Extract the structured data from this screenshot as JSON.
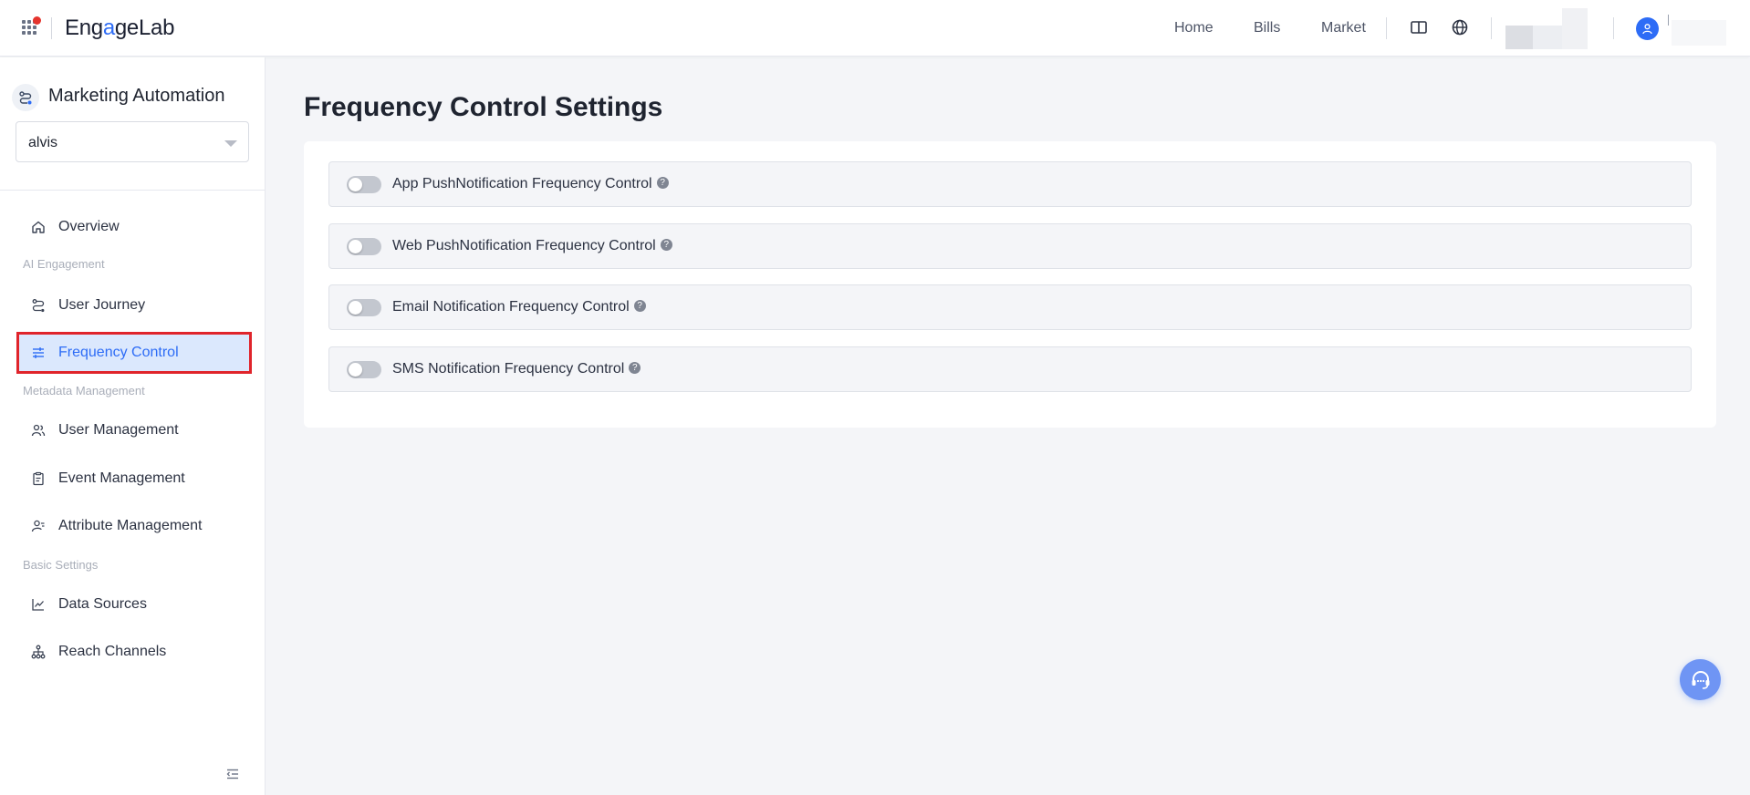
{
  "header": {
    "logo_prefix": "Eng",
    "logo_accent": "a",
    "logo_suffix": "geLab",
    "nav": [
      "Home",
      "Bills",
      "Market"
    ],
    "icons": [
      "apps-grid-icon",
      "book-icon",
      "globe-icon",
      "user-icon"
    ],
    "notification_dot_color": "#e5342d"
  },
  "sidebar": {
    "product_title": "Marketing Automation",
    "project_select_value": "alvis",
    "overview": "Overview",
    "groups": {
      "ai_engagement": "AI Engagement",
      "metadata_management": "Metadata Management",
      "basic_settings": "Basic Settings"
    },
    "items": {
      "user_journey": "User Journey",
      "frequency_control": "Frequency Control",
      "user_management": "User Management",
      "event_management": "Event Management",
      "attribute_management": "Attribute Management",
      "data_sources": "Data Sources",
      "reach_channels": "Reach Channels"
    },
    "active_item": "Frequency Control",
    "accent_color": "#2d6cf6",
    "highlight_border_color": "#e0242b"
  },
  "main": {
    "page_title": "Frequency Control Settings",
    "rows": [
      {
        "label": "App PushNotification Frequency Control",
        "enabled": false
      },
      {
        "label": "Web PushNotification Frequency Control",
        "enabled": false
      },
      {
        "label": "Email Notification Frequency Control",
        "enabled": false
      },
      {
        "label": "SMS Notification Frequency Control",
        "enabled": false
      }
    ],
    "help_glyph": "?"
  }
}
